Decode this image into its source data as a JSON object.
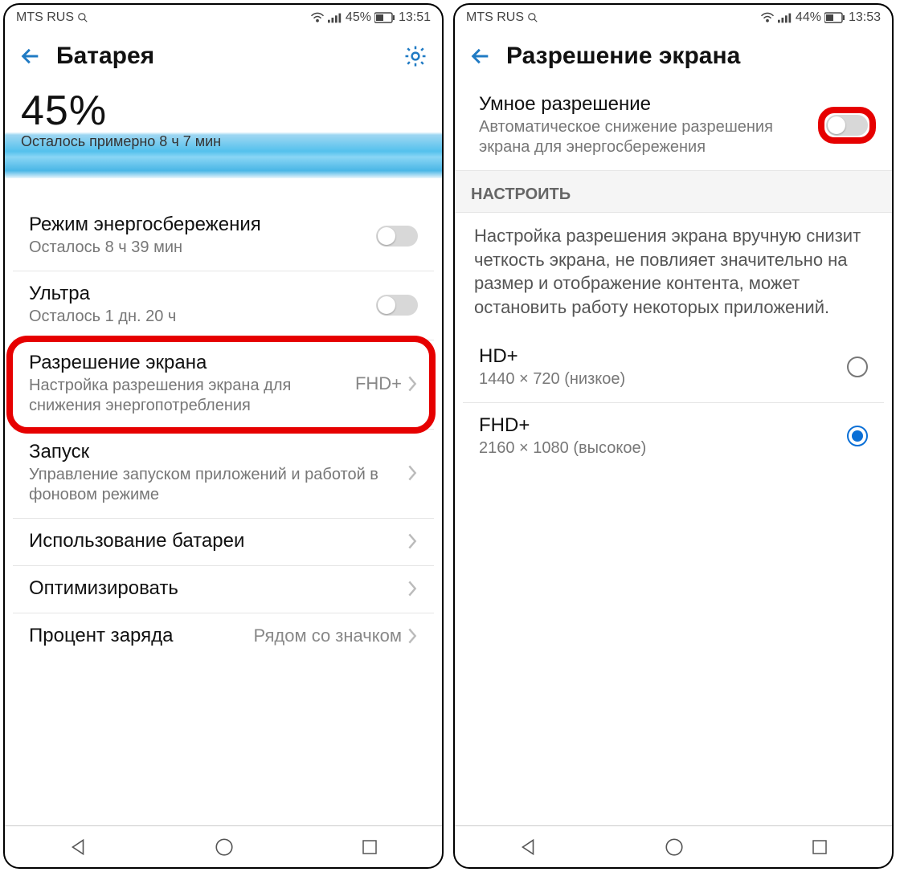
{
  "left": {
    "status": {
      "carrier": "MTS RUS",
      "battery_pct": "45%",
      "time": "13:51"
    },
    "appbar": {
      "title": "Батарея"
    },
    "hero": {
      "pct": "45%",
      "remain": "Осталось примерно 8 ч 7 мин"
    },
    "rows": {
      "power_save": {
        "title": "Режим энергосбережения",
        "sub": "Осталось 8 ч 39 мин"
      },
      "ultra": {
        "title": "Ультра",
        "sub": "Осталось 1 дн. 20 ч"
      },
      "resolution": {
        "title": "Разрешение экрана",
        "sub": "Настройка разрешения экрана для снижения энергопотребления",
        "value": "FHD+"
      },
      "launch": {
        "title": "Запуск",
        "sub": "Управление запуском приложений и работой в фоновом режиме"
      },
      "usage": {
        "title": "Использование батареи"
      },
      "optimize": {
        "title": "Оптимизировать"
      },
      "percent": {
        "title": "Процент заряда",
        "value": "Рядом со значком"
      }
    }
  },
  "right": {
    "status": {
      "carrier": "MTS RUS",
      "battery_pct": "44%",
      "time": "13:53"
    },
    "appbar": {
      "title": "Разрешение экрана"
    },
    "smart": {
      "title": "Умное разрешение",
      "sub": "Автоматическое снижение разрешения экрана для энергосбережения"
    },
    "section": "НАСТРОИТЬ",
    "help": "Настройка разрешения экрана вручную снизит четкость экрана, не повлияет значительно на размер и отображение контента, может остановить работу некоторых приложений.",
    "opts": {
      "hd": {
        "title": "HD+",
        "sub": "1440 × 720 (низкое)"
      },
      "fhd": {
        "title": "FHD+",
        "sub": "2160 × 1080 (высокое)"
      }
    }
  }
}
